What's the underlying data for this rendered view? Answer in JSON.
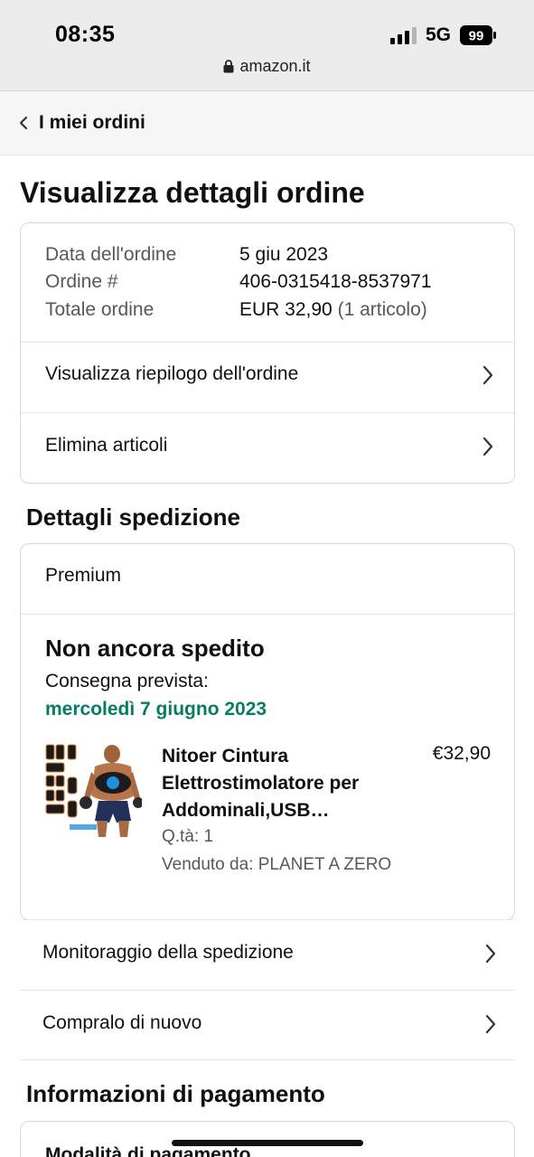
{
  "status_bar": {
    "time": "08:35",
    "network": "5G",
    "battery": "99"
  },
  "browser": {
    "url": "amazon.it"
  },
  "nav": {
    "back_label": "I miei ordini"
  },
  "page": {
    "title": "Visualizza dettagli ordine"
  },
  "order": {
    "date_label": "Data dell'ordine",
    "date_value": "5 giu 2023",
    "number_label": "Ordine #",
    "number_value": "406-0315418-8537971",
    "total_label": "Totale ordine",
    "total_value": "EUR 32,90",
    "total_items": "(1 articolo)",
    "summary_link": "Visualizza riepilogo dell'ordine",
    "remove_link": "Elimina articoli"
  },
  "shipping": {
    "section_title": "Dettagli spedizione",
    "service": "Premium",
    "status": "Non ancora spedito",
    "delivery_label": "Consegna prevista:",
    "delivery_date": "mercoledì 7 giugno 2023",
    "item": {
      "name": "Nitoer Cintura Elettrostimolatore per Addominali,USB…",
      "price": "€32,90",
      "qty": "Q.tà: 1",
      "seller": "Venduto da: PLANET A ZERO"
    },
    "track_link": "Monitoraggio della spedizione",
    "buy_again_link": "Compralo di nuovo"
  },
  "payment": {
    "section_title": "Informazioni di pagamento",
    "method_label": "Modalità di pagamento"
  },
  "colors": {
    "accent_green": "#067d62",
    "text": "#0f1111",
    "muted": "#565959"
  }
}
